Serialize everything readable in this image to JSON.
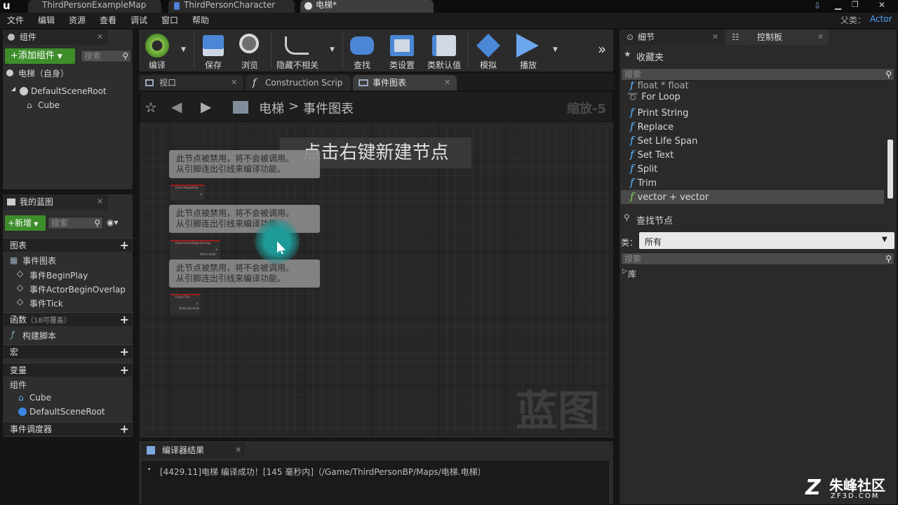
{
  "window": {
    "tabs": [
      "ThirdPersonExampleMap",
      "ThirdPersonCharacter",
      "电梯*"
    ]
  },
  "menu": {
    "items": [
      "文件",
      "编辑",
      "资源",
      "查看",
      "调试",
      "窗口",
      "帮助"
    ],
    "parent_label": "父类：",
    "parent_value": "Actor"
  },
  "components": {
    "title": "组件",
    "add_button": "+添加组件",
    "search_placeholder": "搜索",
    "self": "电梯（自身）",
    "root": "DefaultSceneRoot",
    "child": "Cube"
  },
  "toolbar": {
    "buttons": [
      "编译",
      "保存",
      "浏览",
      "隐藏不相关",
      "查找",
      "类设置",
      "类默认值",
      "模拟",
      "播放"
    ]
  },
  "editor_tabs": [
    "视口",
    "Construction Scrip",
    "事件图表"
  ],
  "breadcrumb": {
    "root": "电梯",
    "separator": ">",
    "current": "事件图表"
  },
  "graph": {
    "zoom": "缩放-5",
    "hint": "点击右键新建节点",
    "watermark": "蓝图",
    "comments": [
      {
        "line1": "此节点被禁用，将不会被调用。",
        "line2": "从引脚连出引线来编译功能。"
      },
      {
        "line1": "此节点被禁用，将不会被调用。",
        "line2": "从引脚连出引线来编译功能。"
      },
      {
        "line1": "此节点被禁用，将不会被调用。",
        "line2": "从引脚连出引线来编译功能。"
      }
    ],
    "nodes": [
      "Event BeginPlay",
      "Event ActorBeginOverlap",
      "Event Tick"
    ],
    "node_pins": [
      "Other Actor",
      "Delta Seconds"
    ]
  },
  "my_blueprint": {
    "title": "我的蓝图",
    "new_button": "+新增",
    "search_placeholder": "搜索",
    "graphs_label": "图表",
    "event_graph": "事件图表",
    "events": [
      "事件BeginPlay",
      "事件ActorBeginOverlap",
      "事件Tick"
    ],
    "functions_label": "函数",
    "functions_count": "（18可覆盖）",
    "construction_script": "构建脚本",
    "macros_label": "宏",
    "variables_label": "变量",
    "components_label": "组件",
    "component_items": [
      "Cube",
      "DefaultSceneRoot"
    ],
    "dispatchers_label": "事件调度器"
  },
  "compiler": {
    "title": "编译器结果",
    "message": "[4429.11]电梯 编译成功！[145 毫秒内]（/Game/ThirdPersonBP/Maps/电梯.电梯）"
  },
  "right_panel": {
    "tabs": [
      "细节",
      "控制板"
    ],
    "favorites_label": "收藏夹",
    "search_placeholder": "搜索",
    "items": [
      "float * float",
      "For Loop",
      "Print String",
      "Replace",
      "Set Life Span",
      "Set Text",
      "Split",
      "Trim",
      "vector + vector"
    ],
    "find_nodes_label": "查找节点",
    "category_label": "类：",
    "category_value": "所有",
    "library_label": "库"
  },
  "watermark_brand": {
    "name": "朱峰社区",
    "url": "ZF3D.COM"
  }
}
